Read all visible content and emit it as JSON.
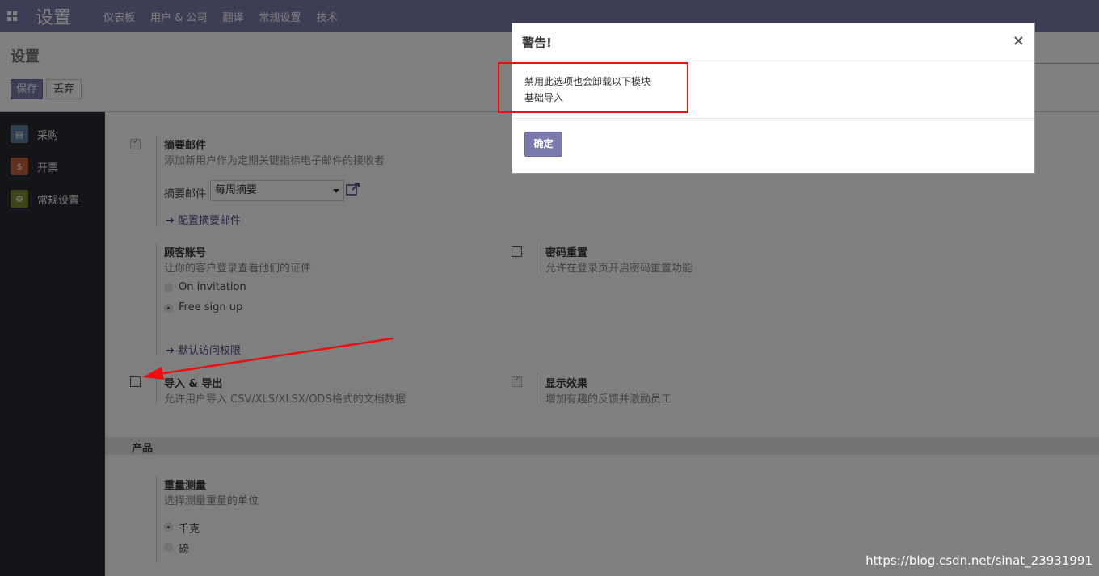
{
  "navbar": {
    "apps_icon": "apps-grid-icon",
    "brand": "设置",
    "items": [
      "仪表板",
      "用户 & 公司",
      "翻译",
      "常规设置",
      "技术"
    ]
  },
  "control_panel": {
    "title": "设置",
    "save_label": "保存",
    "discard_label": "丢弃"
  },
  "sidebar": {
    "items": [
      {
        "label": "采购",
        "icon": "purchase-icon",
        "color": "#5a7fa0"
      },
      {
        "label": "开票",
        "icon": "invoice-icon",
        "color": "#c0623a"
      },
      {
        "label": "常规设置",
        "icon": "settings-gear-icon",
        "color": "#7d8a35"
      }
    ]
  },
  "settings": {
    "digest": {
      "title": "摘要邮件",
      "desc": "添加新用户作为定期关键指标电子邮件的接收者",
      "field_label": "摘要邮件",
      "select_value": "每周摘要",
      "link": "配置摘要邮件",
      "checked": true
    },
    "customer_account": {
      "title": "顾客账号",
      "desc": "让你的客户登录查看他们的证件",
      "options": [
        "On invitation",
        "Free sign up"
      ],
      "selected": "Free sign up",
      "link": "默认访问权限"
    },
    "password_reset": {
      "title": "密码重置",
      "desc": "允许在登录页开启密码重置功能",
      "checked": false
    },
    "import_export": {
      "title": "导入 & 导出",
      "desc": "允许用户导入 CSV/XLS/XLSX/ODS格式的文档数据",
      "checked": false
    },
    "show_effect": {
      "title": "显示效果",
      "desc": "增加有趣的反馈并激励员工",
      "checked": true
    },
    "products_section": "产品",
    "weight": {
      "title": "重量测量",
      "desc": "选择测量重量的单位",
      "options": [
        "千克",
        "磅"
      ],
      "selected": "千克"
    }
  },
  "modal": {
    "title": "警告!",
    "close": "×",
    "line1": "禁用此选项也会卸载以下模块",
    "line2": "基础导入",
    "ok_label": "确定"
  },
  "watermark": "https://blog.csdn.net/sinat_23931991",
  "colors": {
    "brand": "#7c7bad",
    "annotation": "#e81010"
  }
}
